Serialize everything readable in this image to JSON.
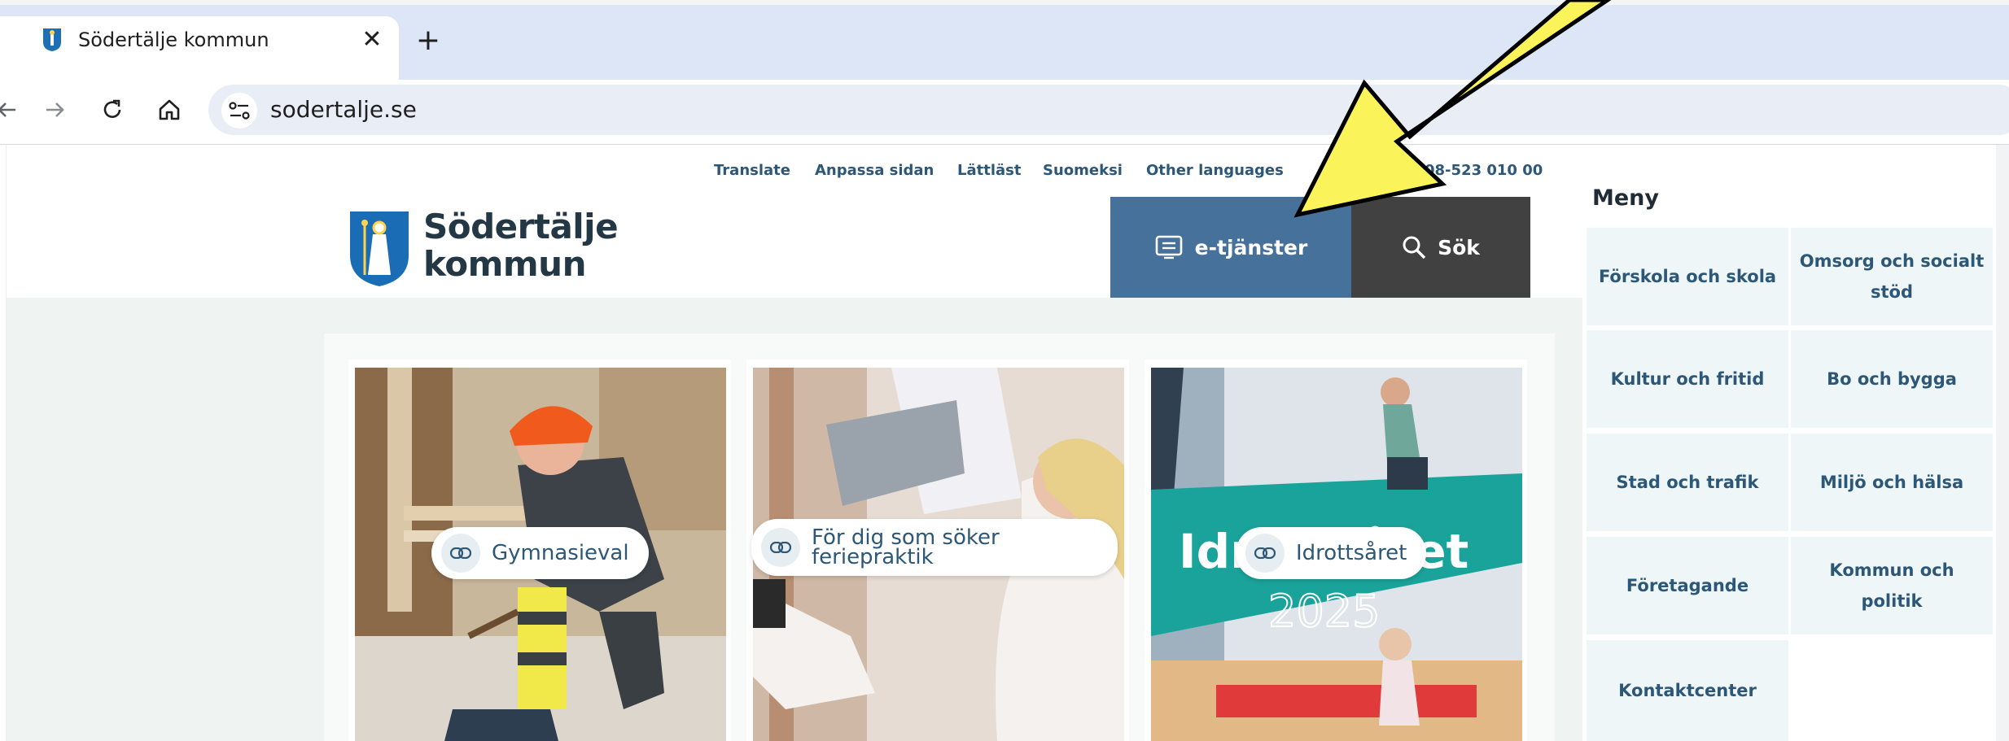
{
  "browser": {
    "tab": {
      "title": "Södertälje kommun",
      "close_glyph": "✕"
    },
    "new_tab_glyph": "+",
    "url": "sodertalje.se",
    "icons": {
      "back": "arrow-left-icon",
      "forward": "arrow-right-icon",
      "reload": "reload-icon",
      "home": "home-icon",
      "site_info": "tune-icon"
    }
  },
  "utility_nav": {
    "links": [
      "Translate",
      "Anpassa sidan",
      "Lättläst",
      "Suomeksi",
      "Other languages"
    ],
    "phone": "08-523 010 00"
  },
  "header": {
    "logo_line1": "Södertälje",
    "logo_line2": "kommun",
    "eservices_label": "e-tjänster",
    "search_label": "Sök",
    "colors": {
      "eservices_bg": "#46719a",
      "search_bg": "#414141"
    }
  },
  "cards": [
    {
      "label": "Gymnasieval"
    },
    {
      "label_line1": "För dig som söker",
      "label_line2": "feriepraktik"
    },
    {
      "label": "Idrottsåret",
      "image_text": "Idrottsåret",
      "image_year": "2025"
    }
  ],
  "menu": {
    "heading": "Meny",
    "items": [
      "Förskola och skola",
      "Omsorg och socialt stöd",
      "Kultur och fritid",
      "Bo och bygga",
      "Stad och trafik",
      "Miljö och hälsa",
      "Företagande",
      "Kommun och politik",
      "Kontaktcenter"
    ]
  },
  "annotation": {
    "arrow_color": "#fbf35a",
    "points_to": "e-tjänster"
  }
}
